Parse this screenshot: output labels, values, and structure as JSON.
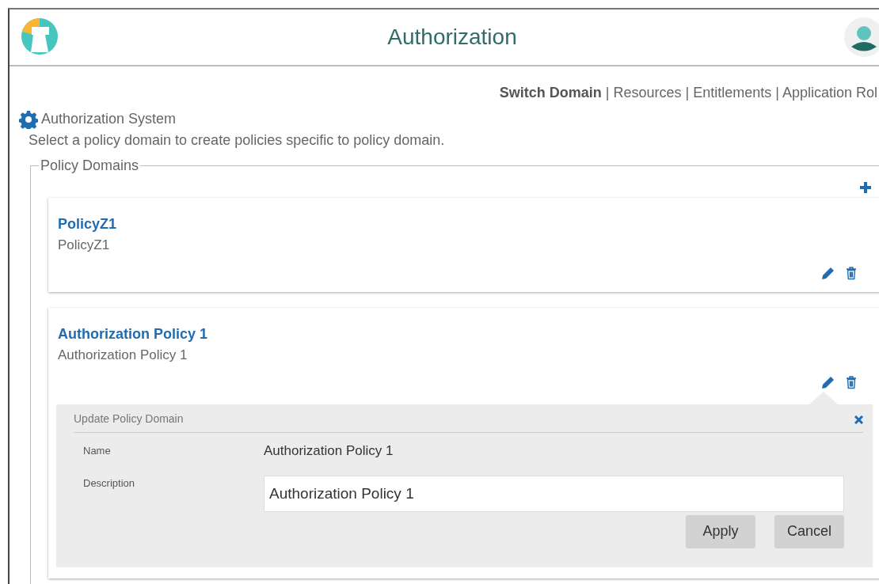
{
  "header": {
    "title": "Authorization"
  },
  "nav_links": [
    {
      "label": "Switch Domain",
      "selected": true
    },
    {
      "label": "Resources",
      "selected": false
    },
    {
      "label": "Entitlements",
      "selected": false
    },
    {
      "label": "Application Rol",
      "selected": false
    }
  ],
  "nav_separators": [
    "|",
    "|",
    "|"
  ],
  "section": {
    "title": "Authorization System",
    "description": "Select a policy domain to create policies specific to policy domain."
  },
  "policy_domains": {
    "legend": "Policy Domains",
    "items": [
      {
        "name": "PolicyZ1",
        "description": "PolicyZ1"
      },
      {
        "name": "Authorization Policy 1",
        "description": "Authorization Policy 1",
        "edit_panel": {
          "title": "Update Policy Domain",
          "name_label": "Name",
          "name_value": "Authorization Policy 1",
          "description_label": "Description",
          "description_value": "Authorization Policy 1",
          "buttons": [
            "Apply",
            "Cancel"
          ]
        }
      }
    ]
  }
}
